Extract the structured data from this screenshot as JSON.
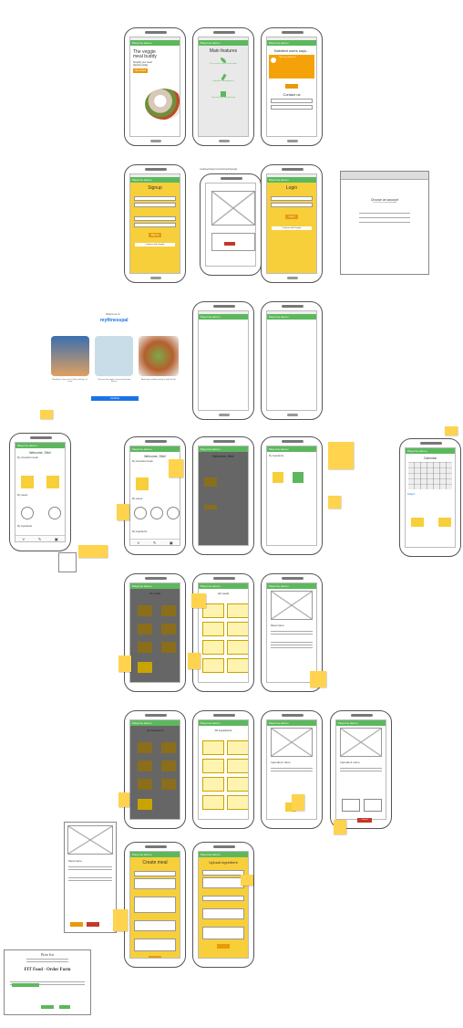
{
  "app_bar": "Рецепты мечты",
  "row1": {
    "hero": {
      "title": "The veggie meal buddy",
      "subtitle": "Simplify your meal planning today",
      "button": "Get started"
    },
    "features": {
      "title": "Main features",
      "items": [
        "The creative and customizable",
        "Ingredient management",
        "Calendar for meal planning"
      ]
    },
    "reviews": {
      "title": "Satisfied users says...",
      "quote": "\"Amazing platform!\"",
      "contact": "Contact us"
    }
  },
  "row2": {
    "signup": {
      "title": "Signup",
      "button": "Sign up",
      "google": "Continue with Google"
    },
    "url": "mealprepbuddy.com/auth/oauth/google",
    "login": {
      "title": "Login",
      "button": "Log in",
      "google": "Continue with Google"
    },
    "google_dialog": {
      "title": "Choose an account",
      "subtitle": "to continue to mealprepbuddy"
    }
  },
  "row3": {
    "welcome": "Welcome to",
    "brand": "myfitnesspal",
    "captions": [
      "Ready for some wins? Start tracking, it's easy!",
      "Discover the impact of your food and fitness",
      "And make mindful eating a habit for life"
    ],
    "continue": "Continue"
  },
  "row4": {
    "welcome": "Welcome, Silvi!",
    "sec_meals": "My scheduled meals",
    "sec_week": "My weeek",
    "sec_ingredients": "My ingredients",
    "calendar": "Calendar",
    "today": "Today's"
  },
  "row5": {
    "title_meals": "All meals",
    "title_my": "All meals",
    "detail": "Meal name"
  },
  "row6": {
    "title_ing": "All ingredients",
    "title_ing2": "All ingredients",
    "detail": "Ingredient name"
  },
  "row7": {
    "create_meal": "Create meal",
    "upload_ingredient": "Upload ingredient",
    "detail": "Meal name",
    "cancel": "Cancel"
  },
  "price": {
    "title": "Price list",
    "form_title": "FIT Food - Order Form"
  },
  "colors": {
    "green": "#5cb85c",
    "yellow": "#f7cf3a",
    "orange": "#e89a0a",
    "sticky": "#ffd34d",
    "blue": "#1a73e8"
  }
}
